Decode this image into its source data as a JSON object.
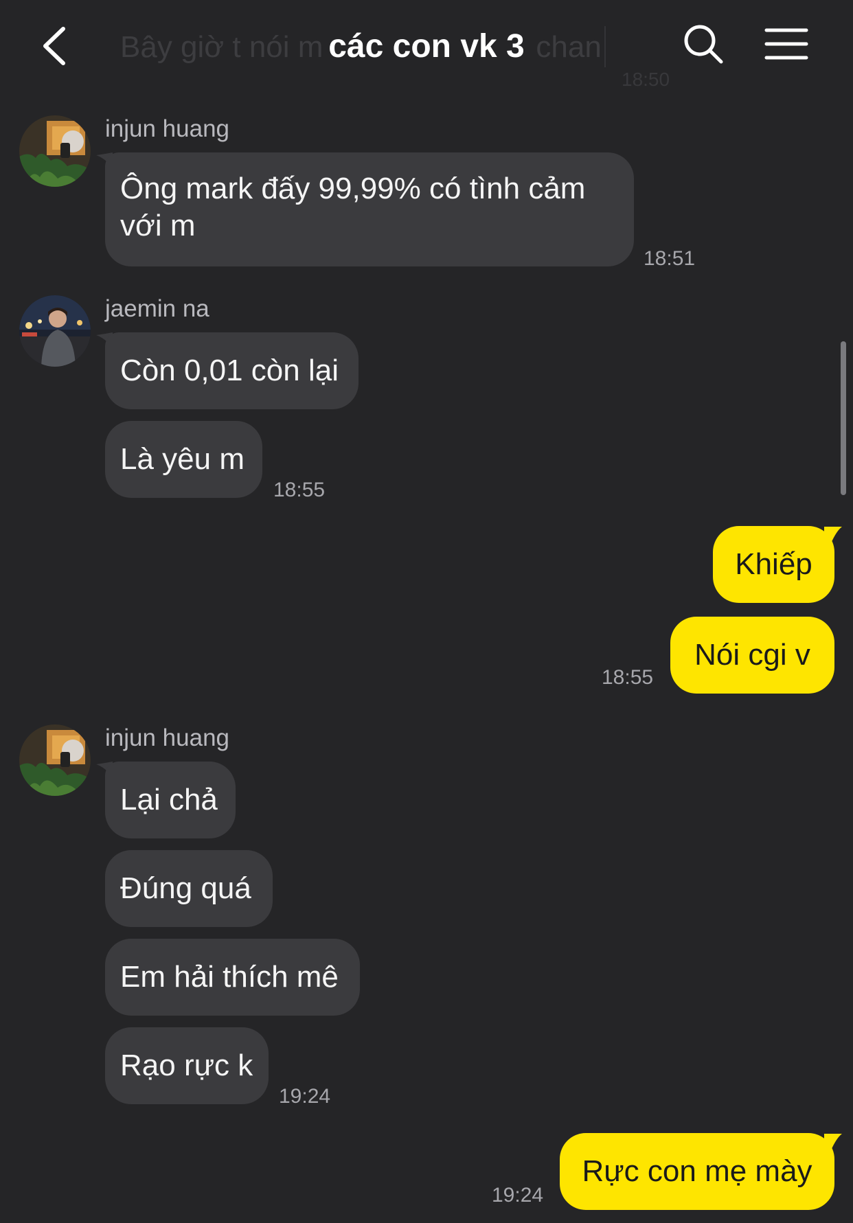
{
  "header": {
    "title": "các con vk 3",
    "back_icon": "chevron-left-icon",
    "search_icon": "search-icon",
    "menu_icon": "hamburger-menu-icon",
    "ghost_text": "Bây giờ t nói m",
    "ghost_text_tail": "chan",
    "ghost_time": "18:50"
  },
  "messages": [
    {
      "sender": "injun huang",
      "text": "Ông mark đấy 99,99% có tình cảm với m",
      "time": "18:51"
    },
    {
      "sender": "jaemin na",
      "text": "Còn 0,01 còn lại"
    },
    {
      "text": "Là yêu m",
      "time": "18:55"
    },
    {
      "sender": "me",
      "text": "Khiếp"
    },
    {
      "sender": "me",
      "text": "Nói cgi v",
      "time": "18:55"
    },
    {
      "sender": "injun huang",
      "text": "Lại chả"
    },
    {
      "text": "Đúng quá"
    },
    {
      "text": "Em hải thích mê"
    },
    {
      "text": "Rạo rực k",
      "time": "19:24"
    },
    {
      "sender": "me",
      "text": "Rực con mẹ mày",
      "time": "19:24"
    }
  ],
  "colors": {
    "background": "#252527",
    "incoming_bubble": "#3b3b3e",
    "outgoing_bubble": "#fee500"
  }
}
